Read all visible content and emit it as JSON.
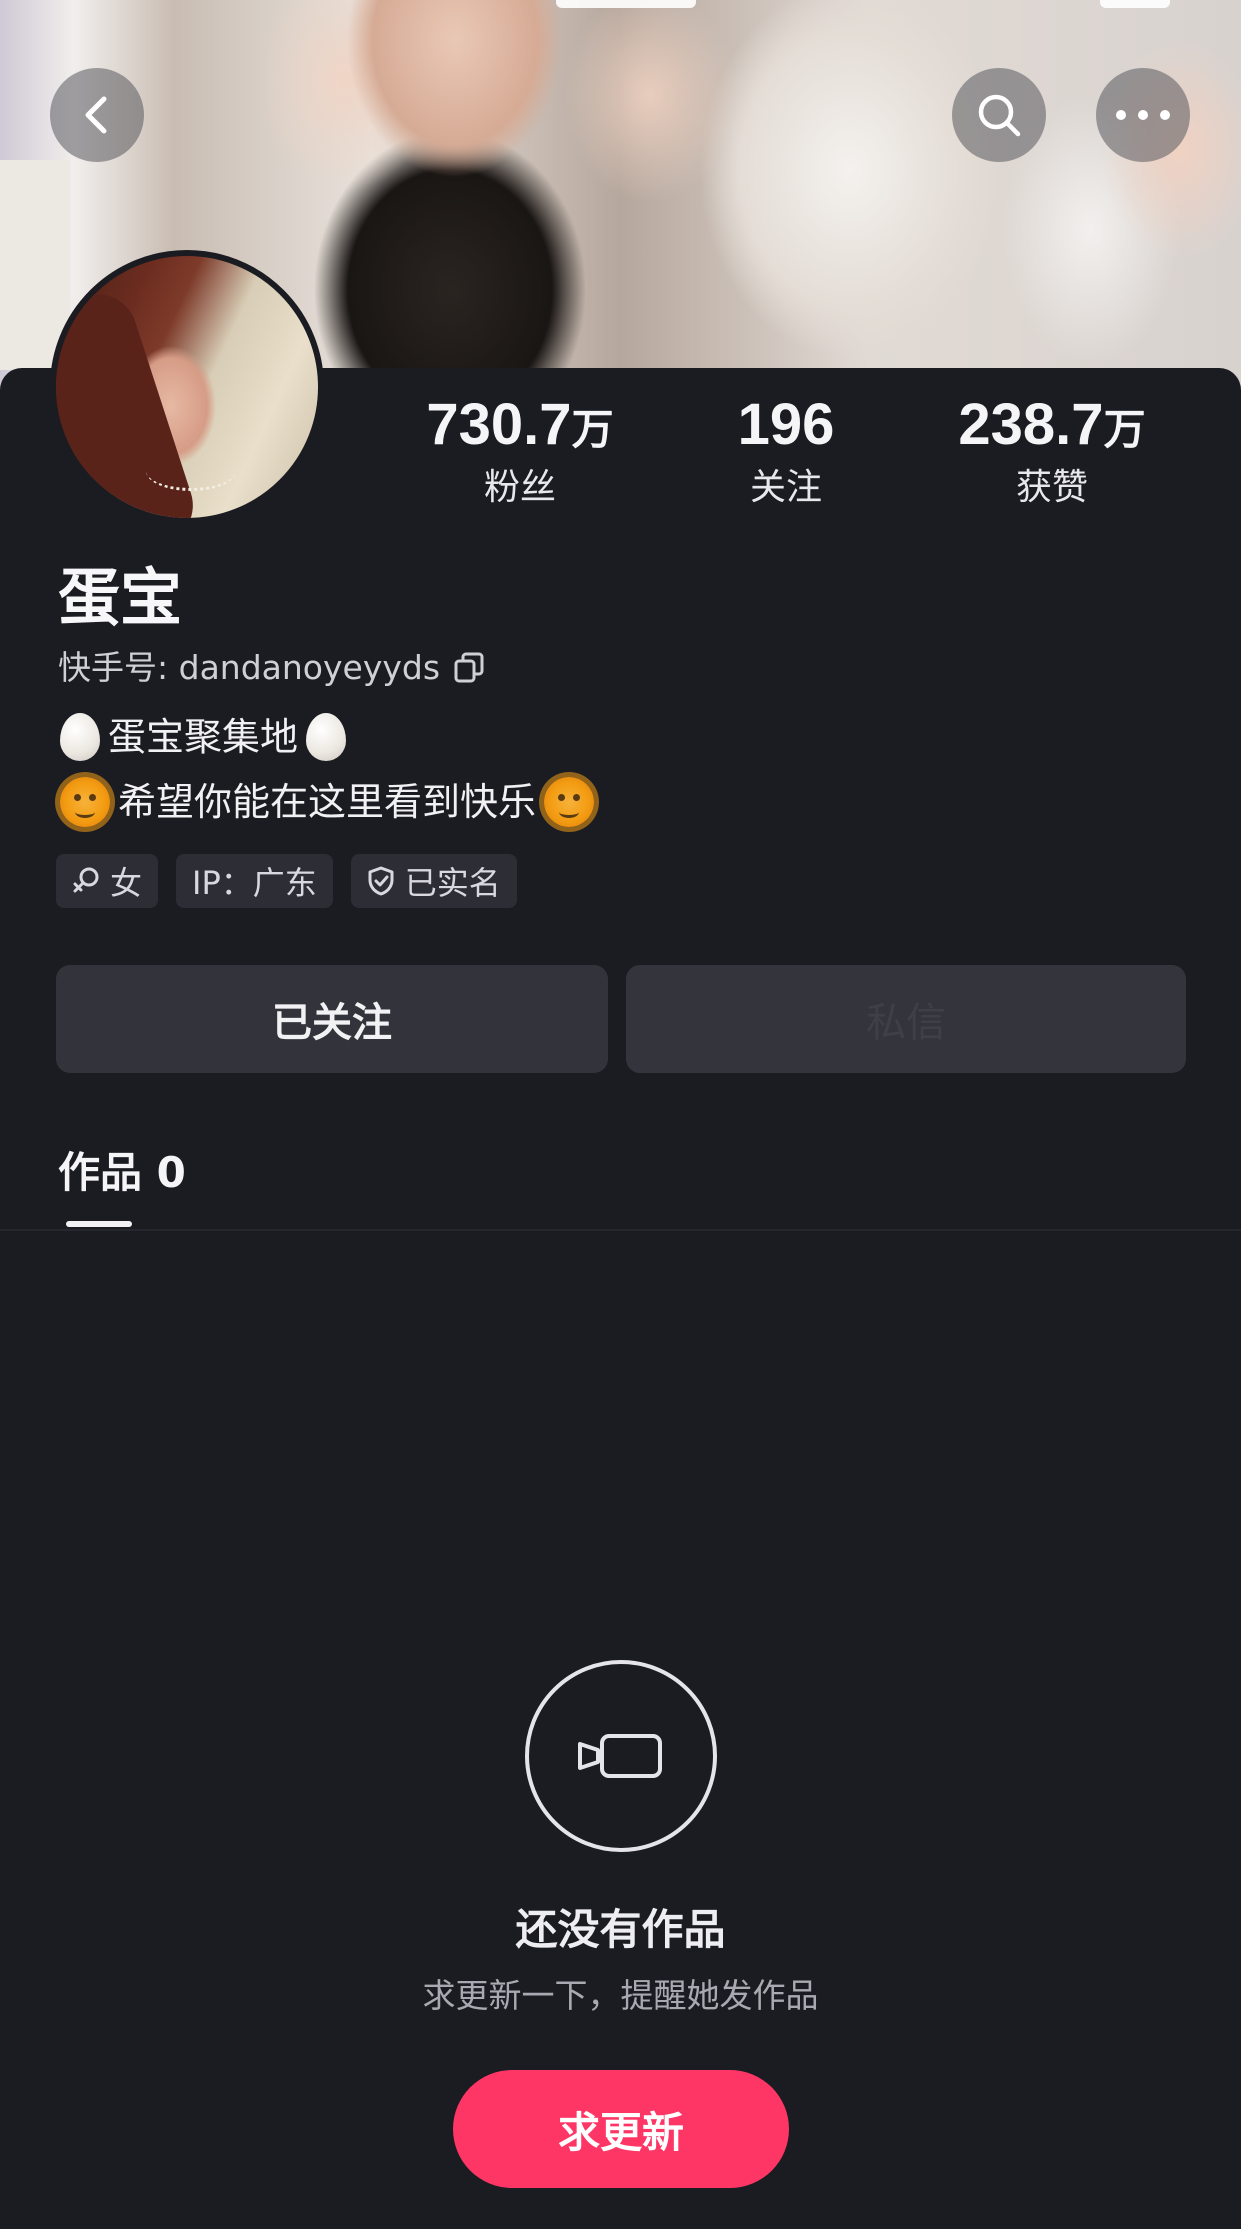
{
  "header": {
    "back_icon": "chevron-left-icon",
    "search_icon": "search-icon",
    "more_icon": "more-dots-icon"
  },
  "profile": {
    "name": "蛋宝",
    "kuaishou_id_label": "快手号:",
    "kuaishou_id": "dandanoyeyyds",
    "bio_line1": "蛋宝聚集地",
    "bio_line2": "希望你能在这里看到快乐",
    "stats": [
      {
        "value": "730.7",
        "unit": "万",
        "label": "粉丝"
      },
      {
        "value": "196",
        "unit": "",
        "label": "关注"
      },
      {
        "value": "238.7",
        "unit": "万",
        "label": "获赞"
      }
    ],
    "tags": {
      "gender": "女",
      "ip": "IP：广东",
      "verified": "已实名"
    }
  },
  "actions": {
    "followed_label": "已关注",
    "message_label": "私信"
  },
  "tabs": {
    "works_label": "作品 0"
  },
  "empty_state": {
    "title": "还没有作品",
    "subtitle": "求更新一下，提醒她发作品",
    "button_label": "求更新"
  },
  "colors": {
    "background": "#1b1b22",
    "accent": "#fe3666",
    "button_bg": "#33333b"
  }
}
